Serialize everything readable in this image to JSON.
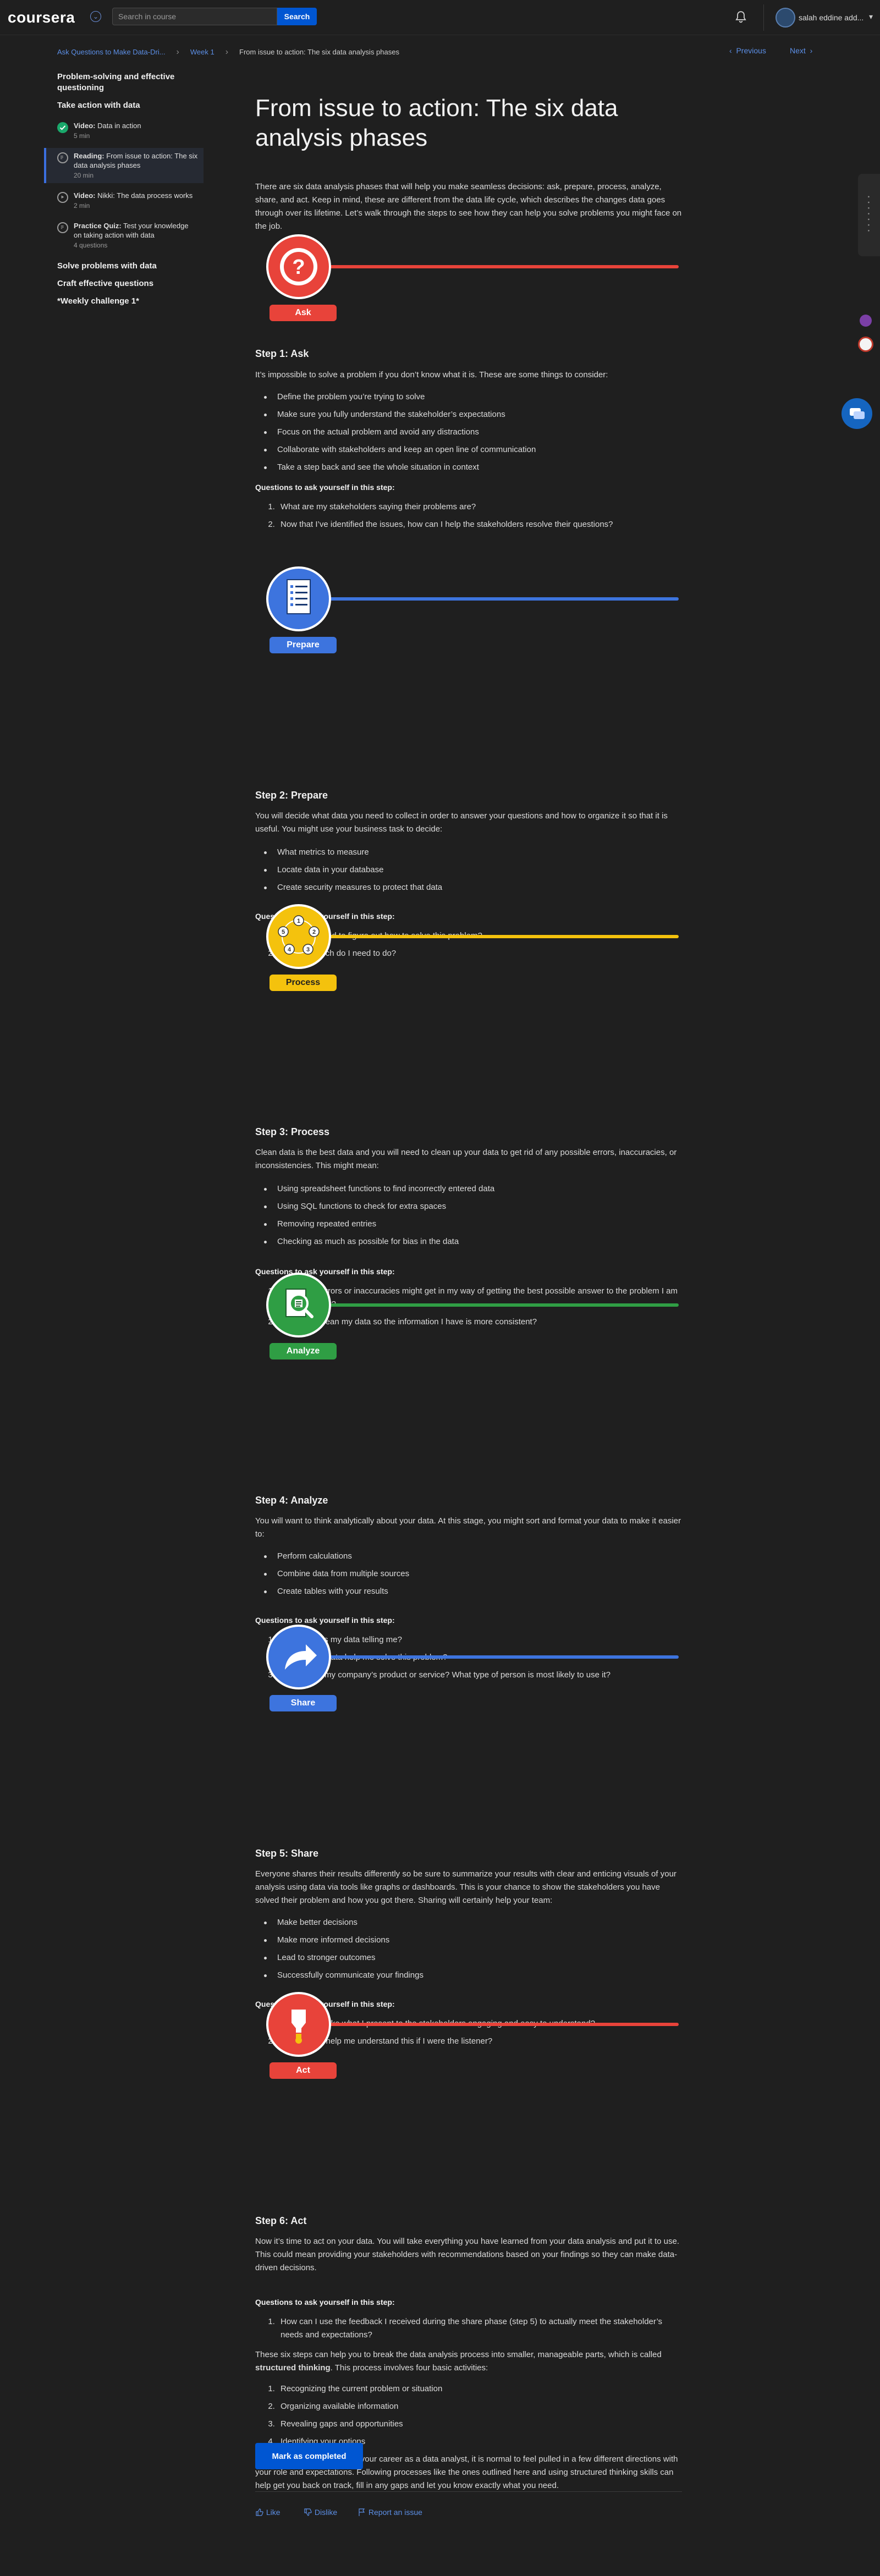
{
  "header": {
    "logo": "coursera",
    "search_placeholder": "Search in course",
    "search_button": "Search",
    "user_name": "salah eddine add...",
    "user_chevron": "▾"
  },
  "breadcrumb": {
    "items": [
      "Ask Questions to Make Data-Dri...",
      "Week 1",
      "From issue to action: The six data analysis phases"
    ],
    "prev": "Previous",
    "next": "Next"
  },
  "sidebar": {
    "module_title": "Problem-solving and effective questioning",
    "lesson_title": "Take action with data",
    "items": [
      {
        "type": "Video:",
        "title": "Data in action",
        "meta": "5 min",
        "status": "done"
      },
      {
        "type": "Reading:",
        "title": "From issue to action: The six data analysis phases",
        "meta": "20 min",
        "status": "active"
      },
      {
        "type": "Video:",
        "title": "Nikki: The data process works",
        "meta": "2 min",
        "status": "todo"
      },
      {
        "type": "Practice Quiz:",
        "title": "Test your knowledge on taking action with data",
        "meta": "4 questions",
        "status": "todo"
      }
    ],
    "sections": [
      "Solve problems with data",
      "Craft effective questions",
      "*Weekly challenge 1*"
    ]
  },
  "main": {
    "title": "From issue to action: The six data analysis phases",
    "intro": "There are six data analysis phases that will help you make seamless decisions: ask, prepare, process, analyze, share, and act. Keep in mind, these are different from the data life cycle, which describes the changes data goes through over its lifetime. Let’s walk through the steps to see how they can help you solve problems you might face on the job.",
    "ask": {
      "pill": "Ask",
      "heading": "Step 1: Ask",
      "intro": "It’s impossible to solve a problem if you don’t know what it is. These are some things to consider:",
      "bullets": [
        "Define the problem you’re trying to solve",
        "Make sure you fully understand the stakeholder’s expectations",
        "Focus on the actual problem and avoid any distractions",
        "Collaborate with stakeholders and keep an open line of communication",
        "Take a step back and see the whole situation in context"
      ],
      "q_heading": "Questions to ask yourself in this step:",
      "questions": [
        "What are my stakeholders saying their problems are?",
        "Now that I’ve identified the issues, how can I help the stakeholders resolve their questions?"
      ]
    },
    "prepare": {
      "pill": "Prepare",
      "heading": "Step 2: Prepare",
      "intro": "You will decide what data you need to collect in order to answer your questions and how to organize it so that it is useful. You might use your business task to decide:",
      "bullets": [
        "What metrics to measure",
        "Locate data in your database",
        "Create security measures to protect that data"
      ],
      "q_heading": "Questions to ask yourself in this step:",
      "questions": [
        "What do I need to figure out how to solve this problem?",
        "What research do I need to do?"
      ]
    },
    "process": {
      "pill": "Process",
      "heading": "Step 3: Process",
      "intro": "Clean data is the best data and you will need to clean up your data to get rid of any possible errors, inaccuracies, or inconsistencies. This might mean:",
      "bullets": [
        "Using spreadsheet functions to find incorrectly entered data",
        "Using SQL functions to check for extra spaces",
        "Removing repeated entries",
        "Checking as much as possible for bias in the data"
      ],
      "q_heading": "Questions to ask yourself in this step:",
      "questions": [
        "What data errors or inaccuracies might get in my way of getting the best possible answer to the problem I am trying to solve?",
        "How can I clean my data so the information I have is more consistent?"
      ]
    },
    "analyze": {
      "pill": "Analyze",
      "heading": "Step 4: Analyze",
      "intro": "You will want to think analytically about your data. At this stage, you might sort and format your data to make it easier to:",
      "bullets": [
        "Perform calculations",
        "Combine data from multiple sources",
        "Create tables with your results"
      ],
      "q_heading": "Questions to ask yourself in this step:",
      "questions": [
        "What story is my data telling me?",
        "How will my data help me solve this problem?",
        "Who needs my company’s product or service? What type of person is most likely to use it?"
      ]
    },
    "share": {
      "pill": "Share",
      "heading": "Step 5: Share",
      "intro": "Everyone shares their results differently so be sure to summarize your results with clear and enticing visuals of your analysis using data via tools like graphs or dashboards. This is your chance to show the stakeholders you have solved their problem and how you got there. Sharing will certainly help your team:",
      "bullets": [
        "Make better decisions",
        "Make more informed decisions",
        "Lead to stronger outcomes",
        "Successfully communicate your findings"
      ],
      "q_heading": "Questions to ask yourself in this step:",
      "questions": [
        "How can I make what I present to the stakeholders engaging and easy to understand?",
        "What would help me understand this if I were the listener?"
      ]
    },
    "act": {
      "pill": "Act",
      "heading": "Step 6: Act",
      "intro": "Now it’s time to act on your data. You will take everything you have learned from your data analysis and put it to use. This could mean providing your stakeholders with recommendations based on your findings so they can make data-driven decisions.",
      "q_heading": "Questions to ask yourself in this step:",
      "questions": [
        "How can I use the feedback I received during the share phase (step 5) to actually meet the stakeholder’s needs and expectations?"
      ],
      "structured_pre": "These six steps can help you to break the data analysis process into smaller, manageable parts, which is called ",
      "structured_bold": "structured thinking",
      "structured_post": ". This process involves four basic activities:",
      "activities": [
        "Recognizing the current problem or situation",
        "Organizing available information",
        "Revealing gaps and opportunities",
        "Identifying your options"
      ],
      "closing": "When you are starting out in your career as a data analyst, it is normal to feel pulled in a few different directions with your role and expectations. Following processes like the ones outlined here and using structured thinking skills can help get you back on track, fill in any gaps and let you know exactly what you need."
    },
    "mark_completed": "Mark as completed",
    "feedback": {
      "like": "Like",
      "dislike": "Dislike",
      "report": "Report an issue"
    }
  },
  "colors": {
    "ask": "#e8433a",
    "prepare": "#3d74de",
    "process": "#f4c20d",
    "analyze": "#2f9e44",
    "share": "#3d74de",
    "act": "#e8433a",
    "accent": "#0056d2"
  },
  "icons": [
    "search-icon",
    "bell-icon",
    "question-mark-icon",
    "checklist-icon",
    "process-cycle-icon",
    "magnifier-doc-icon",
    "share-arrow-icon",
    "lightbulb-icon",
    "thumbs-up-icon",
    "thumbs-down-icon",
    "flag-icon",
    "chat-icon"
  ]
}
